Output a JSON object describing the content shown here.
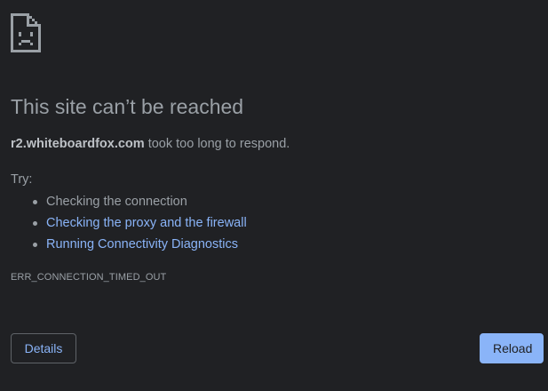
{
  "colors": {
    "background": "#202124",
    "text": "#9aa0a6",
    "link": "#8ab4f8",
    "primary_button": "#8ab4f8"
  },
  "error_page": {
    "icon": "sad-page-icon",
    "title": "This site can’t be reached",
    "host": "r2.whiteboardfox.com",
    "message_suffix": " took too long to respond.",
    "try_label": "Try:",
    "suggestions": [
      {
        "label": "Checking the connection",
        "is_link": false
      },
      {
        "label": "Checking the proxy and the firewall",
        "is_link": true
      },
      {
        "label": "Running Connectivity Diagnostics",
        "is_link": true
      }
    ],
    "error_code": "ERR_CONNECTION_TIMED_OUT"
  },
  "buttons": {
    "details_label": "Details",
    "reload_label": "Reload"
  }
}
